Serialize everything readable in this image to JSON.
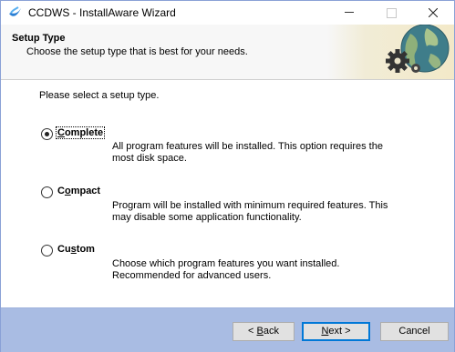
{
  "window": {
    "title": "CCDWS - InstallAware Wizard",
    "accent": "#a9bce3"
  },
  "header": {
    "title": "Setup Type",
    "subtitle": "Choose the setup type that is best for your needs."
  },
  "content": {
    "prompt": "Please select a setup type.",
    "options": [
      {
        "label_pre": "",
        "label_key": "C",
        "label_post": "omplete",
        "selected": true,
        "description_line1": "All program features will be installed. This option requires the",
        "description_line2": "most disk space."
      },
      {
        "label_pre": "C",
        "label_key": "o",
        "label_post": "mpact",
        "selected": false,
        "description_line1": "Program will be installed with minimum required features. This",
        "description_line2": "may disable some application functionality."
      },
      {
        "label_pre": "Cu",
        "label_key": "s",
        "label_post": "tom",
        "selected": false,
        "description_line1": "Choose which program features you want installed.",
        "description_line2": "Recommended for advanced users."
      }
    ]
  },
  "buttons": {
    "back_pre": "< ",
    "back_key": "B",
    "back_post": "ack",
    "next_key": "N",
    "next_post": "ext >",
    "cancel": "Cancel"
  }
}
